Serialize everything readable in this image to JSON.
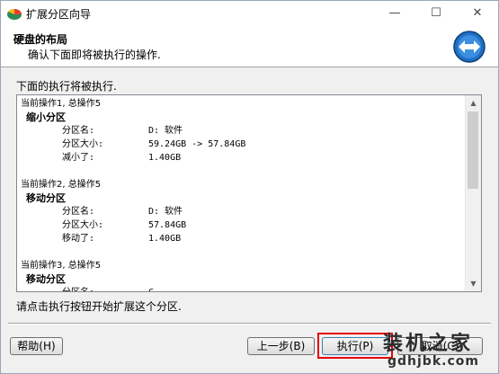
{
  "window": {
    "title": "扩展分区向导",
    "minimize": "—",
    "maximize": "☐",
    "close": "✕"
  },
  "header": {
    "title": "硬盘的布局",
    "subtitle": "确认下面即将被执行的操作."
  },
  "section_label": "下面的执行将被执行.",
  "operations": [
    {
      "head": "当前操作1, 总操作5",
      "type": "缩小分区",
      "rows": [
        {
          "key": "分区名:",
          "value": "D: 软件"
        },
        {
          "key": "分区大小:",
          "value": "59.24GB -> 57.84GB"
        },
        {
          "key": "减小了:",
          "value": "1.40GB"
        }
      ]
    },
    {
      "head": "当前操作2, 总操作5",
      "type": "移动分区",
      "rows": [
        {
          "key": "分区名:",
          "value": "D: 软件"
        },
        {
          "key": "分区大小:",
          "value": "57.84GB"
        },
        {
          "key": "移动了:",
          "value": "1.40GB"
        }
      ]
    },
    {
      "head": "当前操作3, 总操作5",
      "type": "移动分区",
      "rows": [
        {
          "key": "分区名:",
          "value": "C"
        }
      ]
    }
  ],
  "hint": "请点击执行按钮开始扩展这个分区.",
  "buttons": {
    "help": "帮助(H)",
    "back": "上一步(B)",
    "execute": "执行(P)",
    "cancel": "取消(C)"
  },
  "watermark": {
    "text": "装机之家",
    "url": "gdhjbk.com"
  },
  "colors": {
    "highlight": "#e60000",
    "header_icon": "#1f6fc2"
  },
  "icons": {
    "app": "partition-app-icon",
    "header": "arrows-lr-icon"
  }
}
